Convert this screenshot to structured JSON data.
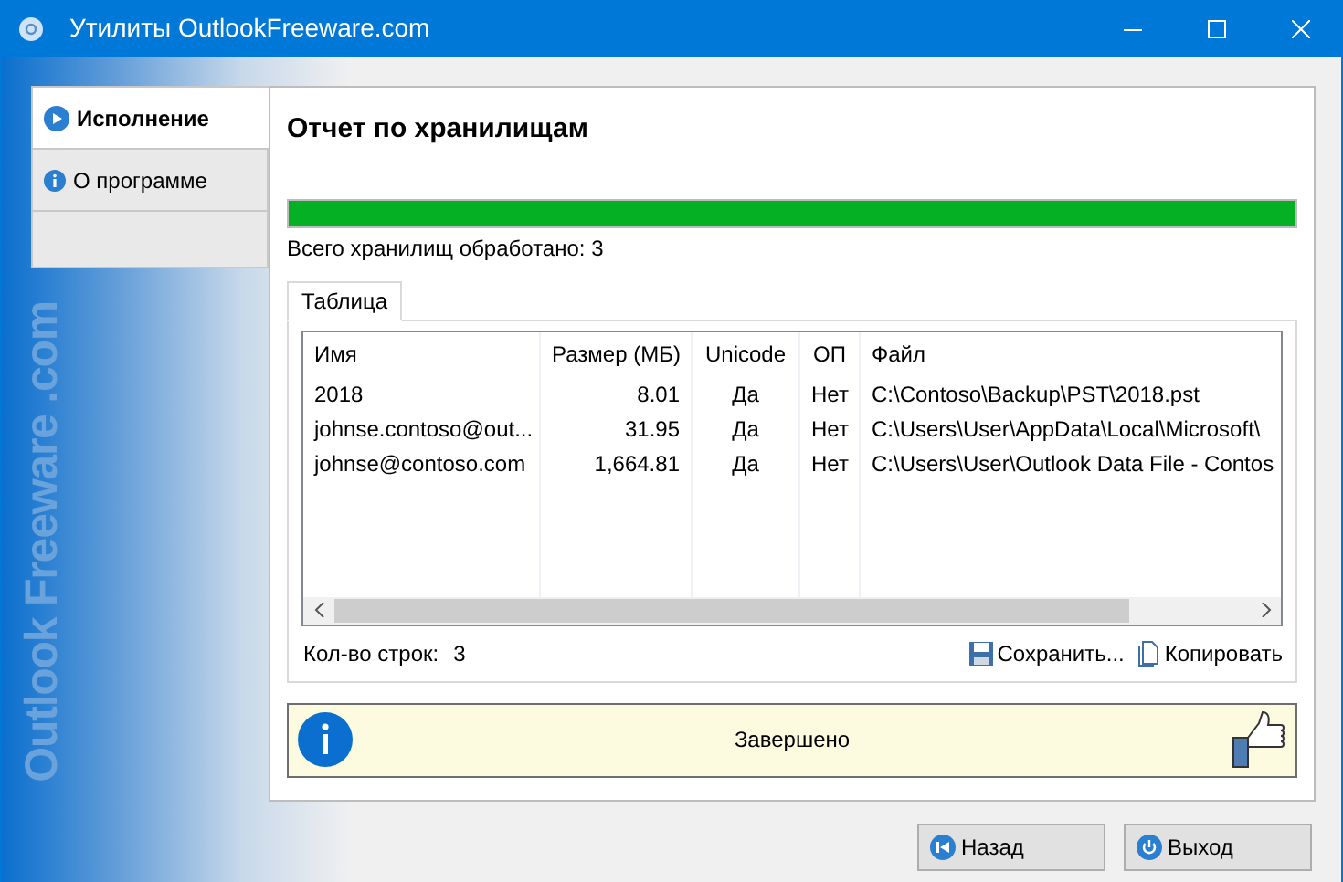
{
  "window": {
    "title": "Утилиты OutlookFreeware.com"
  },
  "sidebar": {
    "brand": "Outlook Freeware .com",
    "items": [
      {
        "label": "Исполнение",
        "selected": true,
        "kind": "play"
      },
      {
        "label": "О программе",
        "selected": false,
        "kind": "info"
      }
    ]
  },
  "heading": "Отчет по хранилищам",
  "progress": {
    "level": 1
  },
  "processed": "Всего хранилищ обработано: 3",
  "tabs": [
    {
      "label": "Таблица",
      "selected": true
    }
  ],
  "table": {
    "columns": [
      "Имя",
      "Размер (МБ)",
      "Unicode",
      "ОП",
      "Файл"
    ],
    "rows": [
      [
        "2018",
        "8.01",
        "Да",
        "Нет",
        "C:\\Contoso\\Backup\\PST\\2018.pst"
      ],
      [
        "johnse.contoso@out...",
        "31.95",
        "Да",
        "Нет",
        "C:\\Users\\User\\AppData\\Local\\Microsoft\\"
      ],
      [
        "johnse@contoso.com",
        "1,664.81",
        "Да",
        "Нет",
        "C:\\Users\\User\\Outlook Data File - Contos"
      ]
    ]
  },
  "row_count": {
    "label": "Кол-во строк:",
    "value": "3"
  },
  "actions": [
    {
      "label": "Сохранить...",
      "kind": "save"
    },
    {
      "label": "Копировать",
      "kind": "copy"
    }
  ],
  "status": "Завершено",
  "buttons": [
    {
      "label": "Назад",
      "kind": "back"
    },
    {
      "label": "Выход",
      "kind": "exit"
    }
  ]
}
